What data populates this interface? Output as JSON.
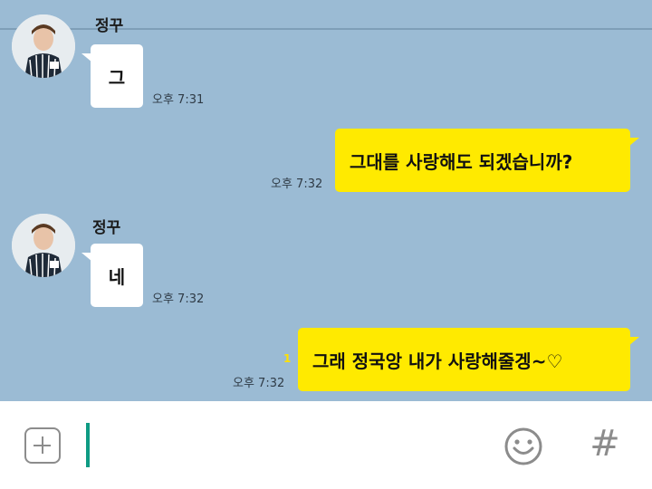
{
  "messages": [
    {
      "direction": "incoming",
      "sender": "정꾸",
      "text": "그",
      "time": "오후 7:31"
    },
    {
      "direction": "outgoing",
      "text": "그대를 사랑해도 되겠습니까?",
      "time": "오후 7:32"
    },
    {
      "direction": "incoming",
      "sender": "정꾸",
      "text": "네",
      "time": "오후 7:32"
    },
    {
      "direction": "outgoing",
      "text": "그래 정국앙 내가 사랑해줄겡~♡",
      "time": "오후 7:32",
      "unread_count": "1"
    }
  ],
  "input_bar": {
    "add_icon": "plus-square-icon",
    "message_value": "",
    "emoji_icon": "smiley-icon",
    "hash_label": "#"
  },
  "colors": {
    "chat_background": "#9bbbd4",
    "outgoing_bubble": "#ffea00",
    "incoming_bubble": "#ffffff",
    "cursor": "#0e9b83",
    "icon_gray": "#8c8c8c",
    "unread_badge": "#ffe100"
  }
}
